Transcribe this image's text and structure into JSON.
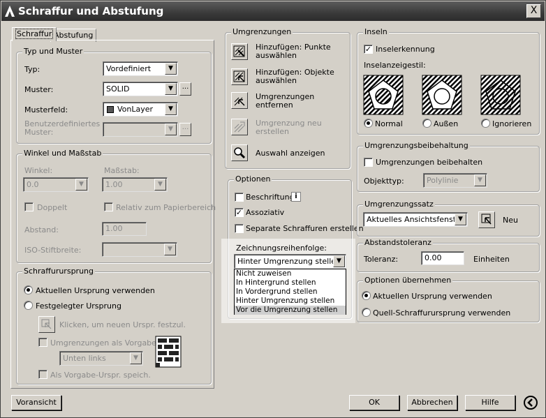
{
  "window": {
    "title": "Schraffur und Abstufung",
    "close_label": "X"
  },
  "tabs": [
    {
      "label": "Schraffur"
    },
    {
      "label": "Abstufung"
    }
  ],
  "typ_und_muster": {
    "legend": "Typ und Muster",
    "typ_label": "Typ:",
    "typ_value": "Vordefiniert",
    "muster_label": "Muster:",
    "muster_value": "SOLID",
    "musterfeld_label": "Musterfeld:",
    "musterfeld_value": "VonLayer",
    "musterfeld_color": "#555555",
    "benutzer_label_1": "Benutzerdefiniertes",
    "benutzer_label_2": "Muster:",
    "ellipsis": "..."
  },
  "winkel": {
    "legend": "Winkel und Maßstab",
    "winkel_label": "Winkel:",
    "winkel_value": "0.0",
    "massstab_label": "Maßstab:",
    "massstab_value": "1.00",
    "doppelt_label": "Doppelt",
    "relativ_label": "Relativ zum Papierbereich",
    "abstand_label": "Abstand:",
    "abstand_value": "1.00",
    "iso_label": "ISO-Stiftbreite:"
  },
  "ursprung": {
    "legend": "Schraffurursprung",
    "aktuell_label": "Aktuellen Ursprung verwenden",
    "festgelegt_label": "Festgelegter Ursprung",
    "klicken_label": "Klicken, um neuen Urspr. festzul.",
    "grenzen_label": "Umgrenzungen als Vorgabe",
    "unten_value": "Unten links",
    "vorgabe_label": "Als Vorgabe-Urspr. speich."
  },
  "umgrenzungen": {
    "legend": "Umgrenzungen",
    "punkte_1": "Hinzufügen: Punkte",
    "punkte_2": "auswählen",
    "objekte_1": "Hinzufügen: Objekte",
    "objekte_2": "auswählen",
    "entfernen_1": "Umgrenzungen",
    "entfernen_2": "entfernen",
    "neu_1": "Umgrenzung neu",
    "neu_2": "erstellen",
    "anzeigen": "Auswahl anzeigen"
  },
  "optionen": {
    "legend": "Optionen",
    "beschriftung": "Beschriftung",
    "info_icon_text": "i",
    "assoziativ": "Assoziativ",
    "separate": "Separate Schraffuren erstellen",
    "reihenfolge_label": "Zeichnungsreihenfolge:",
    "reihenfolge_value": "Hinter Umgrenzung stellen",
    "reihenfolge_options": [
      "Nicht zuweisen",
      "In Hintergrund stellen",
      "In Vordergrund stellen",
      "Hinter Umgrenzung stellen",
      "Vor die Umgrenzung stellen"
    ]
  },
  "inseln": {
    "legend": "Inseln",
    "erkennung": "Inselerkennung",
    "stil_label": "Inselanzeigestil:",
    "normal": "Normal",
    "aussen": "Außen",
    "ignorieren": "Ignorieren"
  },
  "beibehaltung": {
    "legend": "Umgrenzungsbeibehaltung",
    "beibehalten": "Umgrenzungen beibehalten",
    "objekttyp_label": "Objekttyp:",
    "objekttyp_value": "Polylinie"
  },
  "umgrenzungssatz": {
    "legend": "Umgrenzungssatz",
    "value": "Aktuelles Ansichtsfenster",
    "neu": "Neu"
  },
  "abstandstoleranz": {
    "legend": "Abstandstoleranz",
    "toleranz_label": "Toleranz:",
    "toleranz_value": "0.00",
    "einheiten": "Einheiten"
  },
  "uebernehmen": {
    "legend": "Optionen übernehmen",
    "aktuell": "Aktuellen Ursprung verwenden",
    "quell": "Quell-Schraffurursprung verwenden"
  },
  "buttons": {
    "vorschau": "Voransicht",
    "ok": "OK",
    "abbrechen": "Abbrechen",
    "hilfe": "Hilfe"
  }
}
